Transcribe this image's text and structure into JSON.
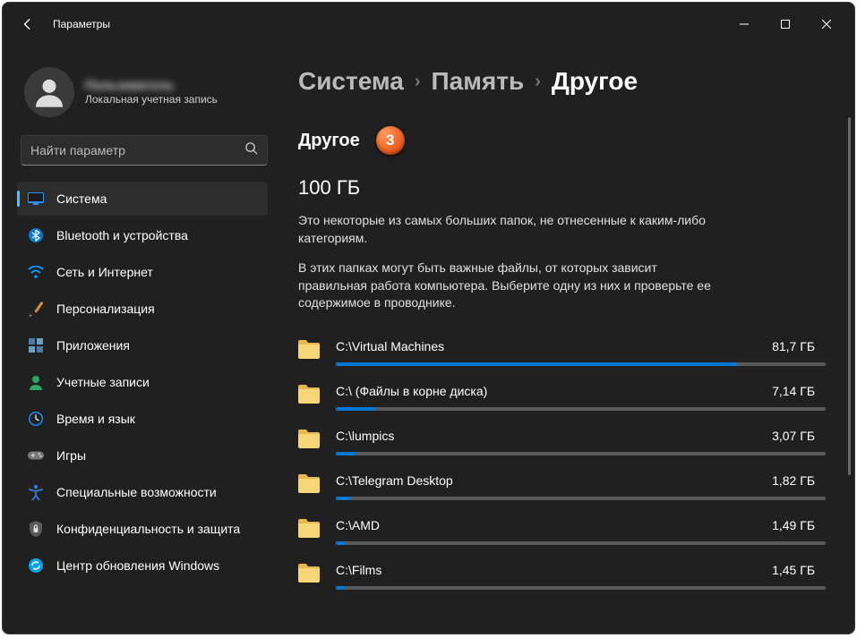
{
  "window": {
    "title": "Параметры"
  },
  "profile": {
    "name": "Пользователь",
    "subtitle": "Локальная учетная запись"
  },
  "search": {
    "placeholder": "Найти параметр"
  },
  "sidebar": {
    "items": [
      {
        "label": "Система",
        "icon": "system",
        "selected": true
      },
      {
        "label": "Bluetooth и устройства",
        "icon": "bluetooth"
      },
      {
        "label": "Сеть и Интернет",
        "icon": "network"
      },
      {
        "label": "Персонализация",
        "icon": "personalization"
      },
      {
        "label": "Приложения",
        "icon": "apps"
      },
      {
        "label": "Учетные записи",
        "icon": "accounts"
      },
      {
        "label": "Время и язык",
        "icon": "time"
      },
      {
        "label": "Игры",
        "icon": "gaming"
      },
      {
        "label": "Специальные возможности",
        "icon": "accessibility"
      },
      {
        "label": "Конфиденциальность и защита",
        "icon": "privacy"
      },
      {
        "label": "Центр обновления Windows",
        "icon": "update"
      }
    ]
  },
  "breadcrumb": {
    "seg1": "Система",
    "seg2": "Память",
    "seg3": "Другое"
  },
  "section": {
    "title": "Другое",
    "badge": "3",
    "total": "100 ГБ",
    "desc1": "Это некоторые из самых больших папок, не отнесенные к каким-либо категориям.",
    "desc2": "В этих папках могут быть важные файлы, от которых зависит правильная работа компьютера. Выберите одну из них и проверьте ее содержимое в проводнике."
  },
  "folders": [
    {
      "path": "C:\\Virtual Machines",
      "size": "81,7 ГБ",
      "pct": 82
    },
    {
      "path": "C:\\ (Файлы в корне диска)",
      "size": "7,14 ГБ",
      "pct": 8
    },
    {
      "path": "C:\\lumpics",
      "size": "3,07 ГБ",
      "pct": 4
    },
    {
      "path": "C:\\Telegram Desktop",
      "size": "1,82 ГБ",
      "pct": 3
    },
    {
      "path": "C:\\AMD",
      "size": "1,49 ГБ",
      "pct": 2
    },
    {
      "path": "C:\\Films",
      "size": "1,45 ГБ",
      "pct": 2
    }
  ],
  "icons": {
    "system": "#2f8fed",
    "bluetooth": "#0078d4",
    "network": "#0099ff",
    "personalization": "#d88a3a",
    "apps": "#4a7aa5",
    "accounts": "#2aa562",
    "time": "#1a8cff",
    "gaming": "#777",
    "accessibility": "#3a7bd5",
    "privacy": "#5a5a5a",
    "update": "#00a2ed"
  }
}
